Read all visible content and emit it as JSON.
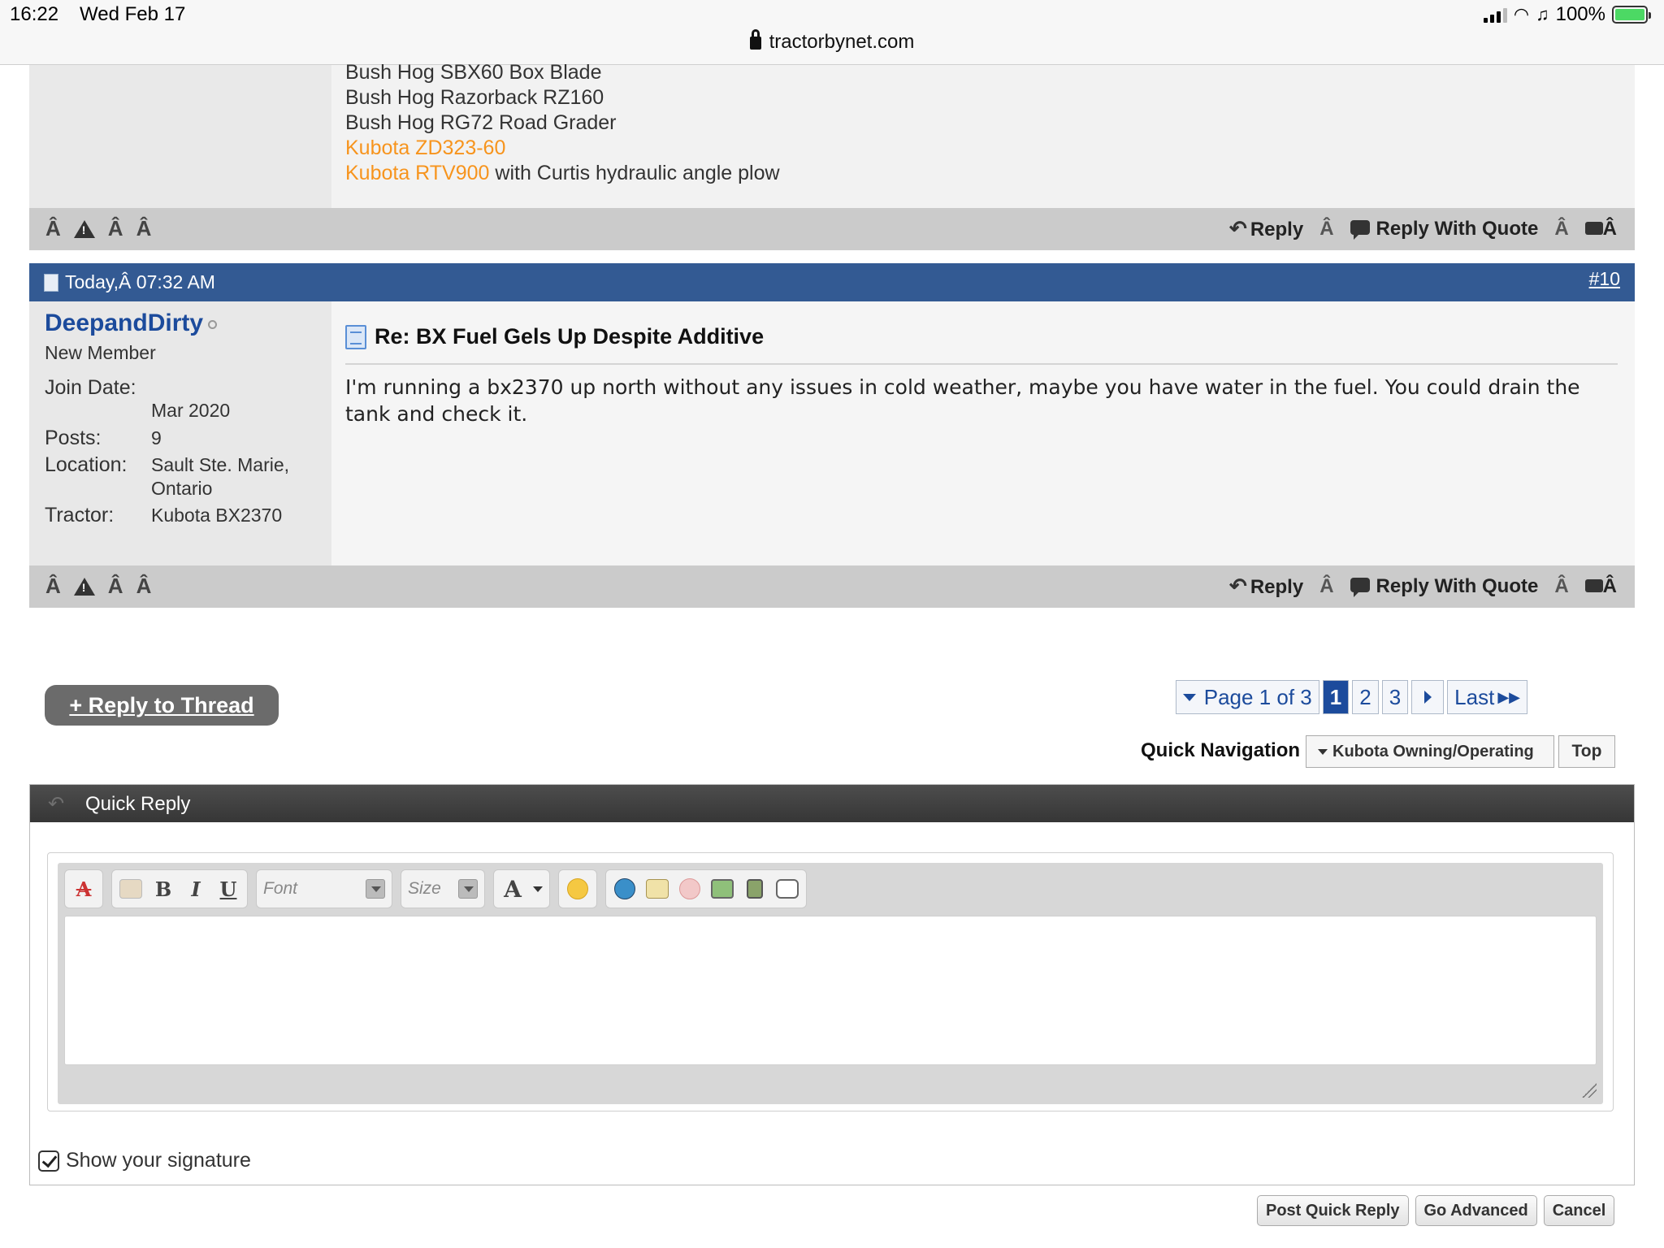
{
  "status_bar": {
    "time": "16:22",
    "date": "Wed Feb 17",
    "url": "tractorbynet.com",
    "battery": "100%"
  },
  "post_prev": {
    "equipment": [
      {
        "name": "Bush Hog SBX60 Box Blade",
        "suffix": "",
        "link": false
      },
      {
        "name": "Bush Hog Razorback RZ160",
        "suffix": "",
        "link": false
      },
      {
        "name": "Bush Hog RG72 Road Grader",
        "suffix": "",
        "link": false
      },
      {
        "name": "Kubota ZD323-60",
        "suffix": "",
        "link": true
      },
      {
        "name": "Kubota RTV900",
        "suffix": " with Curtis hydraulic angle plow",
        "link": true
      }
    ]
  },
  "action_bar": {
    "glyph": "Â",
    "reply_label": "Reply",
    "reply_quote_label": "Reply With Quote"
  },
  "post": {
    "date": "Today,Â 07:32 AM",
    "number": "#10",
    "username": "DeepandDirty",
    "user_title": "New Member",
    "join_label": "Join Date:",
    "join_value": "Mar 2020",
    "posts_label": "Posts:",
    "posts_value": "9",
    "location_label": "Location:",
    "location_line1": "Sault Ste. Marie,",
    "location_line2": "Ontario",
    "tractor_label": "Tractor:",
    "tractor_value": "Kubota BX2370",
    "title": "Re: BX Fuel Gels Up Despite Additive",
    "body": "I'm running a bx2370 up north without any issues in cold weather, maybe you have water in the fuel. You could drain the tank and check it."
  },
  "thread_actions": {
    "reply_to_thread": "+ Reply to Thread"
  },
  "pagination": {
    "label": "Page 1 of 3",
    "pages": [
      "1",
      "2",
      "3"
    ],
    "current": "1",
    "last": "Last"
  },
  "quick_nav": {
    "label": "Quick Navigation",
    "selected": "Kubota Owning/Operating",
    "top": "Top"
  },
  "quick_reply": {
    "title": "Quick Reply",
    "font_placeholder": "Font",
    "size_placeholder": "Size",
    "bold": "B",
    "italic": "I",
    "underline": "U",
    "color_glyph": "A",
    "show_signature": "Show your signature",
    "post_button": "Post Quick Reply",
    "advanced_button": "Go Advanced",
    "cancel_button": "Cancel"
  },
  "colors": {
    "post_header_bg": "#335a93",
    "username": "#1c4b9c",
    "equipment_link": "#f7941d",
    "action_bar_bg": "#cbcbcb",
    "quick_reply_header": "#3f3f3f"
  }
}
